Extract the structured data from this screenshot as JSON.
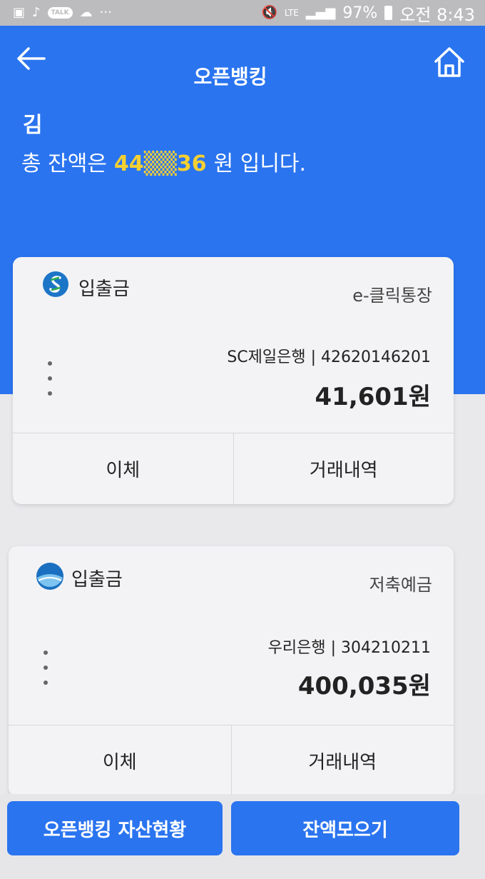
{
  "status_bar": {
    "kakao_label": "TALK",
    "more": "···",
    "network": "LTE",
    "battery_percent": "97%",
    "time": "오전 8:43"
  },
  "header": {
    "title": "오픈뱅킹"
  },
  "summary": {
    "owner_name": "김",
    "total_prefix": "총 잔액은",
    "total_amount": "44",
    "total_amount_suffix": "36",
    "total_unit": "원 입니다."
  },
  "accounts": [
    {
      "type": "입출금",
      "product": "e-클릭통장",
      "account_line": "SC제일은행 | 42620146201",
      "balance": "41,601원",
      "transfer_label": "이체",
      "history_label": "거래내역",
      "logo_color": "#1d75c7"
    },
    {
      "type": "입출금",
      "product": "저축예금",
      "account_line": "우리은행 | 304210211",
      "balance": "400,035원",
      "transfer_label": "이체",
      "history_label": "거래내역",
      "logo_color": "#1a6fc0"
    }
  ],
  "bottom": {
    "assets_label": "오픈뱅킹 자산현황",
    "collect_label": "잔액모으기"
  },
  "colors": {
    "primary": "#2a74ef",
    "highlight": "#f5d033"
  }
}
